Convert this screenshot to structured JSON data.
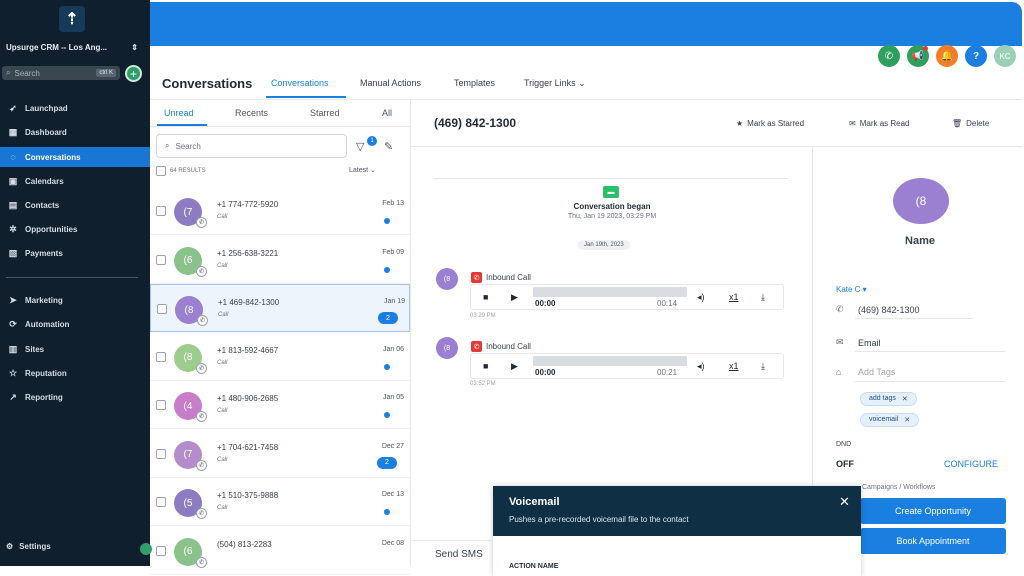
{
  "sidebar": {
    "logo_glyph": "⇡",
    "account": "Upsurge CRM -- Los Ang...",
    "search_placeholder": "Search",
    "search_shortcut": "ctrl K",
    "items": [
      {
        "label": "Launchpad",
        "icon": "rocket-icon"
      },
      {
        "label": "Dashboard",
        "icon": "dashboard-icon"
      },
      {
        "label": "Conversations",
        "icon": "chat-icon"
      },
      {
        "label": "Calendars",
        "icon": "calendar-icon"
      },
      {
        "label": "Contacts",
        "icon": "contacts-icon"
      },
      {
        "label": "Opportunities",
        "icon": "opportunities-icon"
      },
      {
        "label": "Payments",
        "icon": "payments-icon"
      },
      {
        "label": "Marketing",
        "icon": "send-icon"
      },
      {
        "label": "Automation",
        "icon": "automation-icon"
      },
      {
        "label": "Sites",
        "icon": "sites-icon"
      },
      {
        "label": "Reputation",
        "icon": "star-icon"
      },
      {
        "label": "Reporting",
        "icon": "trend-icon"
      }
    ],
    "settings": "Settings",
    "active_color": "#1976d2"
  },
  "topbar": {
    "brand_color": "#1a7fe0",
    "icons": [
      {
        "name": "phone-icon",
        "color": "#2f9f5e",
        "glyph": "✆"
      },
      {
        "name": "megaphone-icon",
        "color": "#2f9f5e",
        "glyph": "📢"
      },
      {
        "name": "bell-icon",
        "color": "#f57c2b",
        "glyph": "🔔"
      },
      {
        "name": "help-icon",
        "color": "#1a7fe0",
        "glyph": "?"
      },
      {
        "name": "avatar-icon",
        "color": "#9ccfb8",
        "glyph": "KC"
      }
    ]
  },
  "header": {
    "title": "Conversations",
    "tabs": [
      "Conversations",
      "Manual Actions",
      "Templates",
      "Trigger Links ⌄"
    ]
  },
  "list": {
    "tabs": [
      "Unread",
      "Recents",
      "Starred",
      "All"
    ],
    "search_placeholder": "Search",
    "filter_badge": "1",
    "results": "64 RESULTS",
    "sort": "Latest ⌄",
    "rows": [
      {
        "avatar": "(7",
        "color": "#8e7cc3",
        "phone": "+1 774-772-5920",
        "sub": "Call",
        "date": "Feb 13",
        "count": ""
      },
      {
        "avatar": "(6",
        "color": "#8bc28b",
        "phone": "+1 256-638-3221",
        "sub": "Call",
        "date": "Feb 09",
        "count": ""
      },
      {
        "avatar": "(8",
        "color": "#9b7fd1",
        "phone": "+1 469-842-1300",
        "sub": "Call",
        "date": "Jan 19",
        "count": "2"
      },
      {
        "avatar": "(8",
        "color": "#9ccc8e",
        "phone": "+1 813-592-4667",
        "sub": "Call",
        "date": "Jan 06",
        "count": ""
      },
      {
        "avatar": "(4",
        "color": "#c77dc7",
        "phone": "+1 480-906-2685",
        "sub": "Call",
        "date": "Jan 05",
        "count": ""
      },
      {
        "avatar": "(7",
        "color": "#b48cc9",
        "phone": "+1 704-621-7458",
        "sub": "Call",
        "date": "Dec 27",
        "count": "2"
      },
      {
        "avatar": "(5",
        "color": "#8e7cc3",
        "phone": "+1 510-375-9888",
        "sub": "Call",
        "date": "Dec 13",
        "count": ""
      },
      {
        "avatar": "(6",
        "color": "#8bc28b",
        "phone": "(504) 813-2283",
        "sub": "",
        "date": "Dec 08",
        "count": ""
      }
    ]
  },
  "conversation": {
    "phone": "(469) 842-1300",
    "actions": [
      "Mark as Starred",
      "Mark as Read",
      "Delete"
    ],
    "began_title": "Conversation began",
    "began_date": "Thu, Jan 19 2023, 03:29 PM",
    "date_chip": "Jan 19th, 2023",
    "messages": [
      {
        "avatar": "(8",
        "label": "Inbound Call",
        "start": "00:00",
        "end": "00:14",
        "speed": "x1",
        "time": "03:29 PM"
      },
      {
        "avatar": "(8",
        "label": "Inbound Call",
        "start": "00:00",
        "end": "00:21",
        "speed": "x1",
        "time": "03:52 PM"
      }
    ],
    "send_sms": "Send SMS"
  },
  "contact": {
    "avatar": "(8",
    "name": "Name",
    "owner": "Kate C ▾",
    "phone": "(469) 842-1300",
    "email_placeholder": "Email",
    "tags_placeholder": "Add Tags",
    "tags": [
      "add tags",
      "voicemail"
    ],
    "dnd_label": "DND",
    "dnd_value": "OFF",
    "configure": "CONFIGURE",
    "campaigns": "Campaigns / Workflows",
    "btn_opportunity": "Create Opportunity",
    "btn_appointment": "Book Appointment"
  },
  "modal": {
    "title": "Voicemail",
    "subtitle": "Pushes a pre-recorded voicemail file to the contact",
    "close": "✕",
    "field_label": "ACTION NAME"
  }
}
